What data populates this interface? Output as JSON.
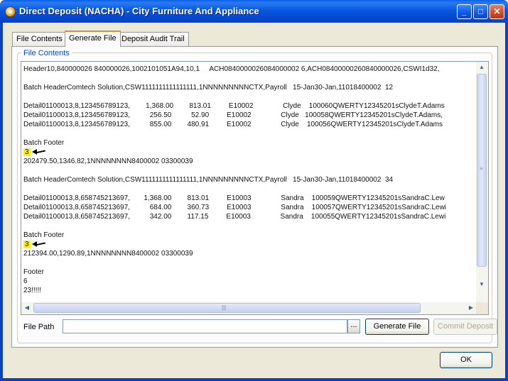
{
  "window": {
    "title": "Direct Deposit (NACHA) - City Furniture And Appliance",
    "minimize_glyph": "_",
    "maximize_glyph": "□",
    "close_glyph": "✕"
  },
  "tabs": [
    {
      "label": "File Contents"
    },
    {
      "label": "Generate File"
    },
    {
      "label": "Deposit Audit Trail"
    }
  ],
  "active_tab": "Generate File",
  "file_contents": {
    "group_label": "File Contents",
    "lines": [
      "Header10,840000026 840000026,1002101051A94,10,1     ACH0840000026084000002 6,ACH08400000260840000026,CSWI1d32,",
      "",
      "Batch HeaderComtech Solution,CSW1111111111111111,1NNNNNNNNNCTX,Payroll   15-Jan30-Jan,11018400002  12",
      "",
      "Detail01100013,8,123456789123,        1,368.00        813.01         E10002               Clyde    100060QWERTY12345201sClydeT.Adams",
      "Detail01100013,8,123456789123,          256.50          52.90         E10002               Clyde   100058QWERTY12345201sClydeT.Adams,",
      "Detail01100013,8,123456789123,          855.00        480.91         E10002               Clyde    100056QWERTY12345201sClydeT.Adams",
      "",
      "Batch Footer",
      "3",
      "202479.50,1346.82,1NNNNNNNN8400002 03300039",
      "",
      "Batch HeaderComtech Solution,CSW1111111111111111,1NNNNNNNNNCTX,Payroll   15-Jan30-Jan,11018400002  34",
      "",
      "Detail01100013,8,658745213697,       1,368.00        813.01         E10003               Sandra    100059QWERTY12345201sSandraC.Lew",
      "Detail01100013,8,658745213697,          684.00        360.73         E10003               Sandra    100057QWERTY12345201sSandraC.Lewi",
      "Detail01100013,8,658745213697,          342.00        117.15         E10003               Sandra    100055QWERTY12345201sSandraC.Lewi",
      "",
      "Batch Footer",
      "3",
      "212394.00,1290.89,1NNNNNNNN8400002 03300039",
      "",
      "Footer",
      "6",
      "23!!!!!"
    ],
    "highlighted_lines": [
      9,
      19
    ],
    "highlight_color": "#fff200"
  },
  "file_path": {
    "label": "File Path",
    "value": "",
    "browse_label": "..."
  },
  "buttons": {
    "generate": "Generate File",
    "commit": "Commit Deposit",
    "ok": "OK"
  }
}
